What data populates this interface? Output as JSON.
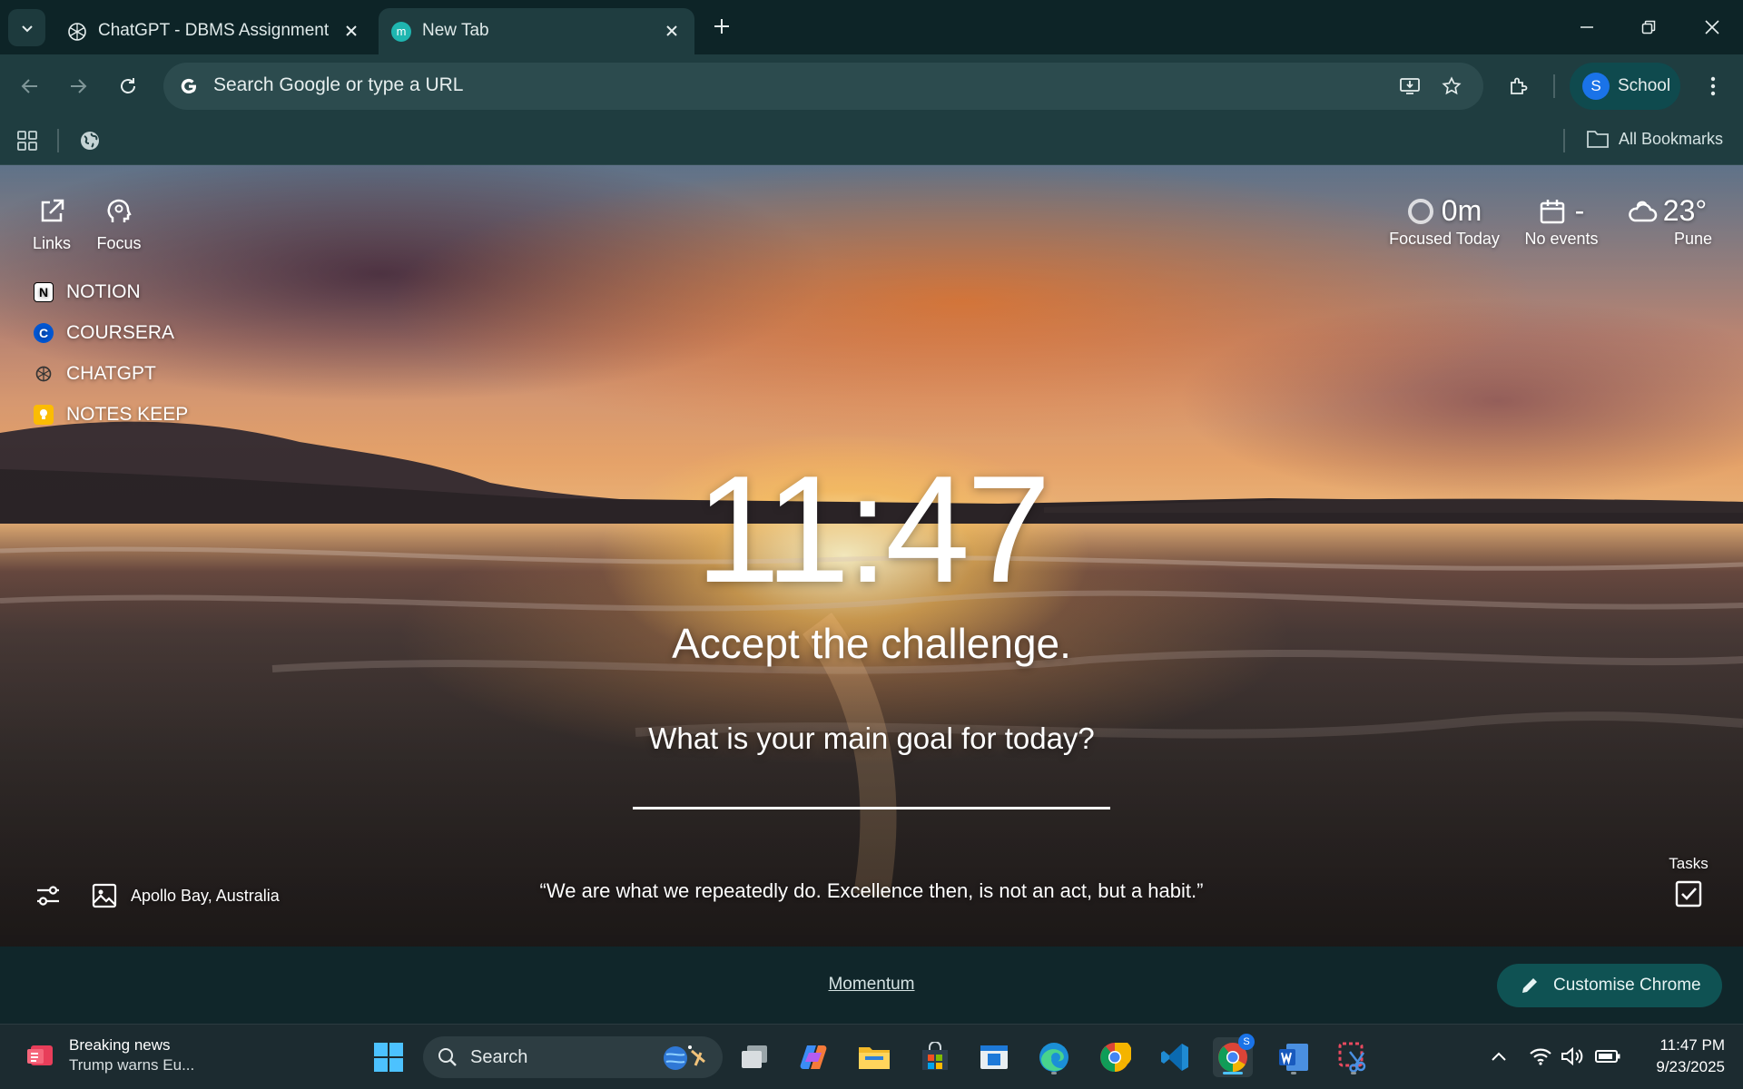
{
  "browser": {
    "tabs": [
      {
        "title": "ChatGPT - DBMS Assignment",
        "active": false
      },
      {
        "title": "New Tab",
        "active": true
      }
    ],
    "omnibox_placeholder": "Search Google or type a URL",
    "profile": {
      "initial": "S",
      "label": "School"
    },
    "bookmarks": {
      "all_bookmarks_label": "All Bookmarks"
    }
  },
  "momentum": {
    "top_left": {
      "links_label": "Links",
      "focus_label": "Focus"
    },
    "top_right": {
      "focus": {
        "value": "0m",
        "label": "Focused Today"
      },
      "calendar": {
        "value": "-",
        "label": "No events"
      },
      "weather": {
        "value": "23°",
        "label": "Pune"
      }
    },
    "links": [
      {
        "label": "NOTION",
        "icon": "notion-icon"
      },
      {
        "label": "COURSERA",
        "icon": "coursera-icon"
      },
      {
        "label": "CHATGPT",
        "icon": "chatgpt-icon"
      },
      {
        "label": "NOTES KEEP",
        "icon": "keep-icon"
      }
    ],
    "clock": "11:47",
    "mantra": "Accept the challenge.",
    "goal_question": "What is your main goal for today?",
    "goal_value": "",
    "photo_location": "Apollo Bay, Australia",
    "quote": "“We are what we repeatedly do. Excellence then, is not an act, but a habit.”",
    "tasks_label": "Tasks"
  },
  "footer": {
    "momentum_link": "Momentum",
    "customise_label": "Customise Chrome"
  },
  "taskbar": {
    "news_title": "Breaking news",
    "news_subtitle": "Trump warns Eu...",
    "search_label": "Search",
    "time": "11:47 PM",
    "date": "9/23/2025",
    "chrome_badge": "S"
  },
  "colors": {
    "chrome_frame": "#0d2427",
    "toolbar": "#1f3d40",
    "omnibox": "#2c4b4e",
    "profile_chip": "#0f4a4e",
    "customise_button": "#0f5253",
    "taskbar": "#1c2b30",
    "accent_blue": "#1a73e8"
  }
}
